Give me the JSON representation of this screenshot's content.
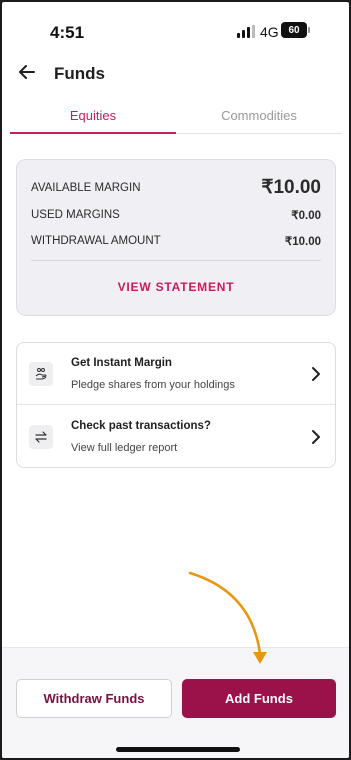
{
  "status_bar": {
    "time": "4:51",
    "network": "4G",
    "battery": "60"
  },
  "header": {
    "title": "Funds"
  },
  "tabs": [
    {
      "label": "Equities",
      "active": true
    },
    {
      "label": "Commodities",
      "active": false
    }
  ],
  "margin_summary": {
    "rows": [
      {
        "label": "AVAILABLE MARGIN",
        "value": "₹10.00"
      },
      {
        "label": "USED MARGINS",
        "value": "₹0.00"
      },
      {
        "label": "WITHDRAWAL AMOUNT",
        "value": "₹10.00"
      }
    ],
    "view_statement_label": "VIEW STATEMENT"
  },
  "actions": [
    {
      "title": "Get Instant Margin",
      "subtitle": "Pledge shares from your holdings",
      "icon": "pledge-icon"
    },
    {
      "title": "Check past transactions?",
      "subtitle": "View full ledger report",
      "icon": "transfer-arrows-icon"
    }
  ],
  "footer": {
    "withdraw_label": "Withdraw Funds",
    "add_label": "Add Funds"
  },
  "colors": {
    "accent": "#c81d5b",
    "primary_button": "#9a1249",
    "annotation_arrow": "#e8950f"
  }
}
